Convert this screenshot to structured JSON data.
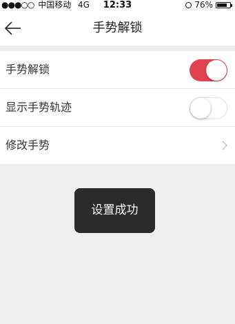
{
  "status_bar": {
    "signal": "●●●○○",
    "carrier": "中国移动",
    "network": "4G",
    "time": "12:33",
    "battery_percent": "76%",
    "battery_level": 0.76
  },
  "nav": {
    "title": "手势解锁",
    "back_icon": "arrow-left-icon"
  },
  "settings": {
    "rows": [
      {
        "label": "手势解锁",
        "control": "switch",
        "on": true
      },
      {
        "label": "显示手势轨迹",
        "control": "switch",
        "on": false
      },
      {
        "label": "修改手势",
        "control": "chevron",
        "icon": "chevron-right-icon"
      }
    ]
  },
  "toast": {
    "message": "设置成功"
  },
  "colors": {
    "switch_on": "#e0434f",
    "background": "#efefef",
    "toast_bg": "#2b2b2b"
  }
}
